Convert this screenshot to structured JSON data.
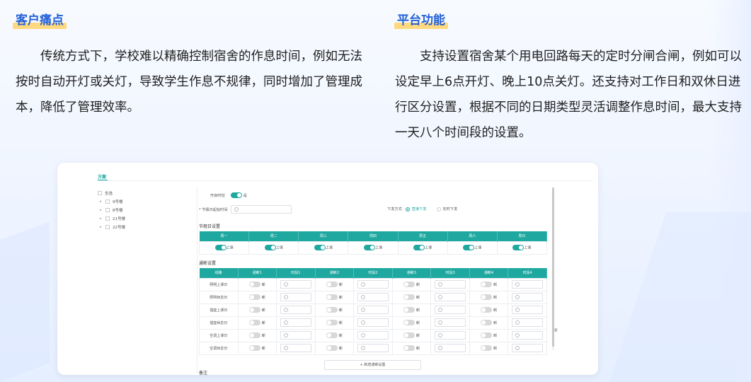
{
  "left_section": {
    "title": "客户痛点",
    "paragraph": "传统方式下，学校难以精确控制宿舍的作息时间，例如无法按时自动开灯或关灯，导致学生作息不规律，同时增加了管理成本，降低了管理效率。"
  },
  "right_section": {
    "title": "平台功能",
    "paragraph": "支持设置宿舍某个用电回路每天的定时分闸合闸，例如可以设定早上6点开灯、晚上10点关灯。还支持对工作日和双休日进行区分设置，根据不同的日期类型灵活调整作息时间，最大支持一天八个时间段的设置。"
  },
  "app": {
    "tab_label": "方案",
    "tree": {
      "all_label": "全选",
      "buildings": [
        "9号楼",
        "8号楼",
        "21号楼",
        "22号楼"
      ]
    },
    "enable_label": "开启时控",
    "enable_value": "是",
    "holiday_time_label": "* 节假日起始时间",
    "dispatch_label": "下发方式",
    "dispatch_options": [
      "直接下发",
      "定时下发"
    ],
    "holiday_section_label": "节假日设置",
    "weekdays": [
      "周一",
      "周二",
      "周三",
      "周四",
      "周五",
      "周六",
      "周日"
    ],
    "weekday_state": "上课",
    "breaker_section_label": "通断设置",
    "breaker_headers": [
      "线路",
      "通断1",
      "时段1",
      "通断2",
      "时段2",
      "通断3",
      "时段3",
      "通断4",
      "时段4"
    ],
    "breaker_rows": [
      "照明上课日",
      "照明休息日",
      "插座上课日",
      "插座休息日",
      "空调上课日",
      "空调休息日"
    ],
    "breaker_state": "断",
    "add_button": "+ 新增通断设置",
    "side_text": "折",
    "remark_label": "备注"
  }
}
